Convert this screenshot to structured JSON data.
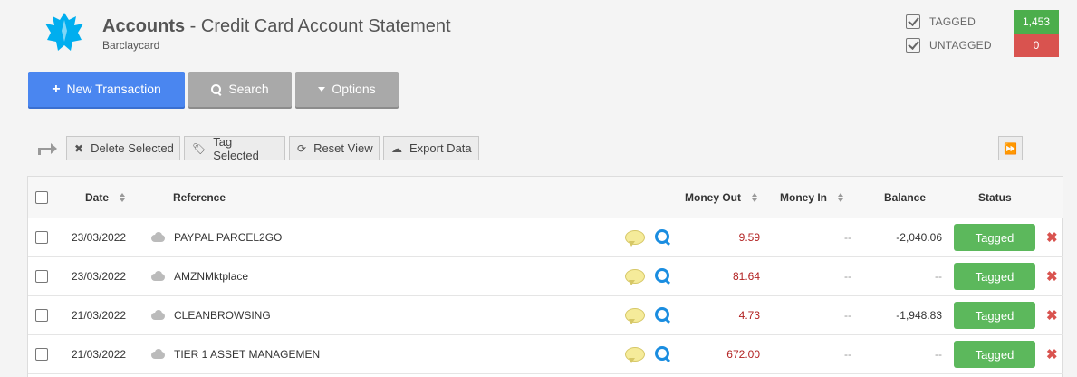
{
  "header": {
    "title_bold": "Accounts",
    "title_rest": " - Credit Card Account Statement",
    "subtitle": "Barclaycard"
  },
  "tags": {
    "tagged_label": "TAGGED",
    "tagged_count": "1,453",
    "untagged_label": "UNTAGGED",
    "untagged_count": "0"
  },
  "actions": {
    "new_transaction": "New Transaction",
    "search": "Search",
    "options": "Options"
  },
  "toolbar": {
    "delete_selected": "Delete Selected",
    "tag_selected": "Tag Selected",
    "reset_view": "Reset View",
    "export_data": "Export Data"
  },
  "table": {
    "headers": {
      "date": "Date",
      "reference": "Reference",
      "money_out": "Money Out",
      "money_in": "Money In",
      "balance": "Balance",
      "status": "Status"
    },
    "rows": [
      {
        "date": "23/03/2022",
        "reference": "PAYPAL PARCEL2GO",
        "money_out": "9.59",
        "money_in": "--",
        "balance": "-2,040.06",
        "status": "Tagged"
      },
      {
        "date": "23/03/2022",
        "reference": "AMZNMktplace",
        "money_out": "81.64",
        "money_in": "--",
        "balance": "--",
        "status": "Tagged"
      },
      {
        "date": "21/03/2022",
        "reference": "CLEANBROWSING",
        "money_out": "4.73",
        "money_in": "--",
        "balance": "-1,948.83",
        "status": "Tagged"
      },
      {
        "date": "21/03/2022",
        "reference": "TIER 1 ASSET MANAGEMEN",
        "money_out": "672.00",
        "money_in": "--",
        "balance": "--",
        "status": "Tagged"
      }
    ]
  },
  "colors": {
    "primary": "#4a86f0",
    "tagged_green": "#4cae4c",
    "untagged_red": "#d9534f",
    "money_out": "#b22222",
    "search_icon": "#1a8de0"
  }
}
